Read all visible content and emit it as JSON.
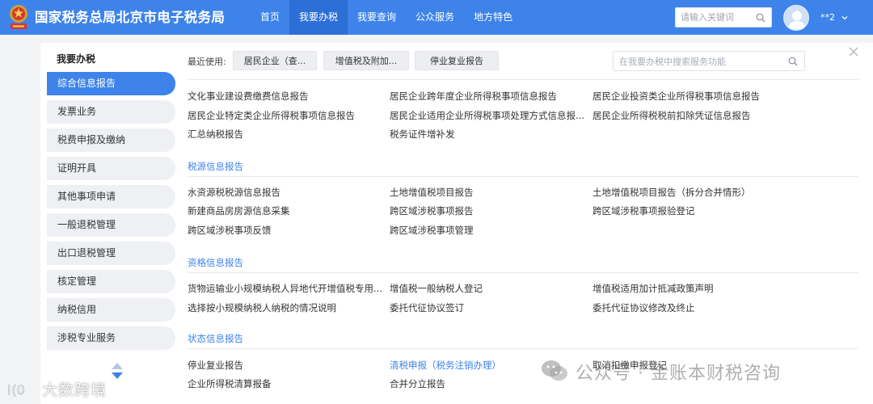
{
  "header": {
    "title": "国家税务总局北京市电子税务局",
    "nav": [
      {
        "label": "首页",
        "active": false
      },
      {
        "label": "我要办税",
        "active": true
      },
      {
        "label": "我要查询",
        "active": false
      },
      {
        "label": "公众服务",
        "active": false
      },
      {
        "label": "地方特色",
        "active": false
      }
    ],
    "search_placeholder": "请输入关键词",
    "user_name": "**2"
  },
  "sidebar": {
    "title": "我要办税",
    "items": [
      {
        "label": "综合信息报告",
        "active": true
      },
      {
        "label": "发票业务",
        "active": false
      },
      {
        "label": "税费申报及缴纳",
        "active": false
      },
      {
        "label": "证明开具",
        "active": false
      },
      {
        "label": "其他事项申请",
        "active": false
      },
      {
        "label": "一般退税管理",
        "active": false
      },
      {
        "label": "出口退税管理",
        "active": false
      },
      {
        "label": "核定管理",
        "active": false
      },
      {
        "label": "纳税信用",
        "active": false
      },
      {
        "label": "涉税专业服务",
        "active": false
      }
    ]
  },
  "recent": {
    "label": "最近使用:",
    "items": [
      "居民企业（查...",
      "增值税及附加...",
      "停业复业报告"
    ]
  },
  "function_search_placeholder": "在我要办税中搜索服务功能",
  "sections": [
    {
      "title": "",
      "links": [
        [
          "文化事业建设费缴费信息报告",
          "居民企业跨年度企业所得税事项信息报告",
          "居民企业投资类企业所得税事项信息报告"
        ],
        [
          "居民企业特定类企业所得税事项信息报告",
          "居民企业适用企业所得税事项处理方式信息报...",
          "居民企业所得税税前扣除凭证信息报告"
        ],
        [
          "汇总纳税报告",
          "税务证件增补发",
          ""
        ]
      ]
    },
    {
      "title": "税源信息报告",
      "links": [
        [
          "水资源税税源信息报告",
          "土地增值税项目报告",
          "土地增值税项目报告（拆分合并情形）"
        ],
        [
          "新建商品房房源信息采集",
          "跨区域涉税事项报告",
          "跨区域涉税事项报验登记"
        ],
        [
          "跨区域涉税事项反馈",
          "跨区域涉税事项管理",
          ""
        ]
      ]
    },
    {
      "title": "资格信息报告",
      "links": [
        [
          "货物运输业小规模纳税人异地代开增值税专用...",
          "增值税一般纳税人登记",
          "增值税适用加计抵减政策声明"
        ],
        [
          "选择按小规模纳税人纳税的情况说明",
          "委托代征协议签订",
          "委托代征协议修改及终止"
        ]
      ]
    },
    {
      "title": "状态信息报告",
      "links": [
        [
          "停业复业报告",
          "清税申报（税务注销办理）",
          "取消扣缴申报登记"
        ],
        [
          "企业所得税清算报备",
          "合并分立报告",
          ""
        ]
      ]
    }
  ],
  "watermark": {
    "left_text": "大数跨境",
    "right_text": "公众号 · 金账本财税咨询"
  },
  "colors": {
    "brand": "#3d83ea",
    "active_nav": "#2c6fd6",
    "page_bg": "#f2f3f5"
  }
}
